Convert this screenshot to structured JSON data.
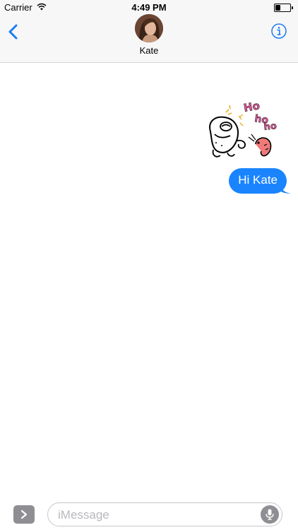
{
  "status_bar": {
    "carrier": "Carrier",
    "time": "4:49 PM",
    "battery_level": 0.4
  },
  "header": {
    "contact_name": "Kate",
    "back_icon": "chevron-left-icon",
    "info_icon": "info-icon",
    "accent_color": "#1a7cf5"
  },
  "conversation": {
    "sticker": {
      "text_lines": [
        "Ho",
        "ho",
        "ho"
      ],
      "text_color": "#e0569a",
      "icon": "laughing-cartoon-sticker"
    },
    "messages": [
      {
        "text": "Hi Kate",
        "sender": "me",
        "color": "#1a84ff"
      }
    ]
  },
  "input_bar": {
    "placeholder": "iMessage",
    "apps_icon": "chevron-right-icon",
    "mic_icon": "microphone-icon"
  }
}
